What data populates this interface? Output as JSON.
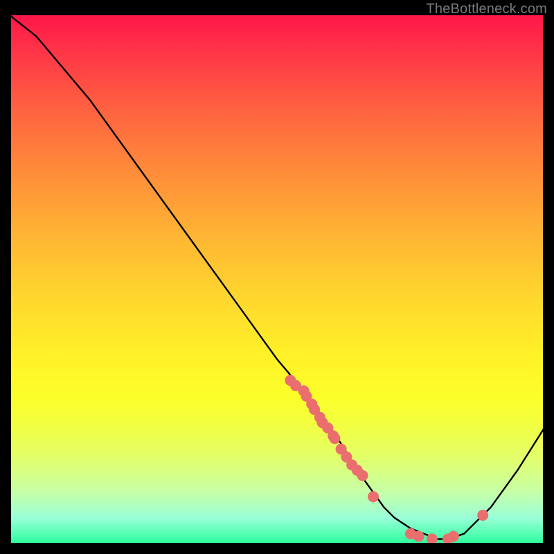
{
  "watermark": "TheBottleneck.com",
  "chart_data": {
    "type": "line",
    "title": "",
    "xlabel": "",
    "ylabel": "",
    "xlim": [
      0,
      100
    ],
    "ylim": [
      0,
      100
    ],
    "grid": false,
    "series": [
      {
        "name": "curve",
        "color": "#000000",
        "x": [
          0,
          5,
          10,
          15,
          20,
          25,
          30,
          35,
          40,
          45,
          50,
          55,
          60,
          62,
          65,
          70,
          72,
          75,
          80,
          82,
          85,
          90,
          95,
          100
        ],
        "y": [
          100,
          96,
          90,
          84,
          77,
          70,
          63,
          56,
          49,
          42,
          35,
          29,
          22,
          19,
          14,
          7,
          5,
          3,
          1,
          1,
          2,
          7,
          14,
          22
        ]
      }
    ],
    "markers": [
      {
        "x": 52.5,
        "y": 31
      },
      {
        "x": 53.5,
        "y": 30
      },
      {
        "x": 55.0,
        "y": 29
      },
      {
        "x": 55.5,
        "y": 28
      },
      {
        "x": 56.5,
        "y": 26.5
      },
      {
        "x": 57.0,
        "y": 25.5
      },
      {
        "x": 58.0,
        "y": 24
      },
      {
        "x": 58.5,
        "y": 23
      },
      {
        "x": 59.5,
        "y": 22
      },
      {
        "x": 60.5,
        "y": 20.5
      },
      {
        "x": 60.8,
        "y": 20
      },
      {
        "x": 62.0,
        "y": 18
      },
      {
        "x": 63.0,
        "y": 16.5
      },
      {
        "x": 64.0,
        "y": 15
      },
      {
        "x": 65.0,
        "y": 14
      },
      {
        "x": 66.0,
        "y": 13
      },
      {
        "x": 68.0,
        "y": 9
      },
      {
        "x": 75.0,
        "y": 2
      },
      {
        "x": 76.5,
        "y": 1.5
      },
      {
        "x": 79.0,
        "y": 1
      },
      {
        "x": 82.0,
        "y": 1
      },
      {
        "x": 83.0,
        "y": 1.5
      },
      {
        "x": 88.5,
        "y": 5.5
      }
    ],
    "marker_style": {
      "color": "#eb6e6e",
      "radius_px": 8
    }
  }
}
